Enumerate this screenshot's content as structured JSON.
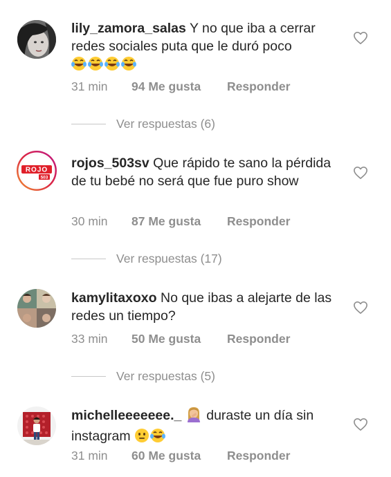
{
  "comments": [
    {
      "username": "lily_zamora_salas",
      "text": "Y no que iba a cerrar redes sociales puta que le duró poco",
      "emojis": [
        "laughing-tears",
        "laughing-tears",
        "laughing-tears",
        "laughing-tears"
      ],
      "time": "31 min",
      "likes": "94 Me gusta",
      "reply": "Responder",
      "view_replies": "Ver respuestas (6)"
    },
    {
      "username": "rojos_503sv",
      "text": "Que rápido te sano la pérdida de tu bebé no será que fue puro show",
      "avatar_logo": "ROJO",
      "avatar_sub": "503",
      "time": "30 min",
      "likes": "87 Me gusta",
      "reply": "Responder",
      "view_replies": "Ver respuestas (17)"
    },
    {
      "username": "kamylitaxoxo",
      "text": "No que ibas a alejarte de las redes un tiempo?",
      "time": "33 min",
      "likes": "50 Me gusta",
      "reply": "Responder",
      "view_replies": "Ver respuestas (5)"
    },
    {
      "username": "michelleeeeeee._",
      "text_after_emoji": "duraste un día sin instagram",
      "leading_emoji": "woman-facepalming",
      "trailing_emojis": [
        "neutral-face",
        "laughing-tears"
      ],
      "time": "31 min",
      "likes": "60 Me gusta",
      "reply": "Responder"
    }
  ],
  "colors": {
    "text": "#262626",
    "muted": "#8e8e8e",
    "divider": "#c7c7c7",
    "story_ring_start": "#f09433",
    "story_ring_end": "#bc1888",
    "rojo_red": "#e0202a"
  }
}
